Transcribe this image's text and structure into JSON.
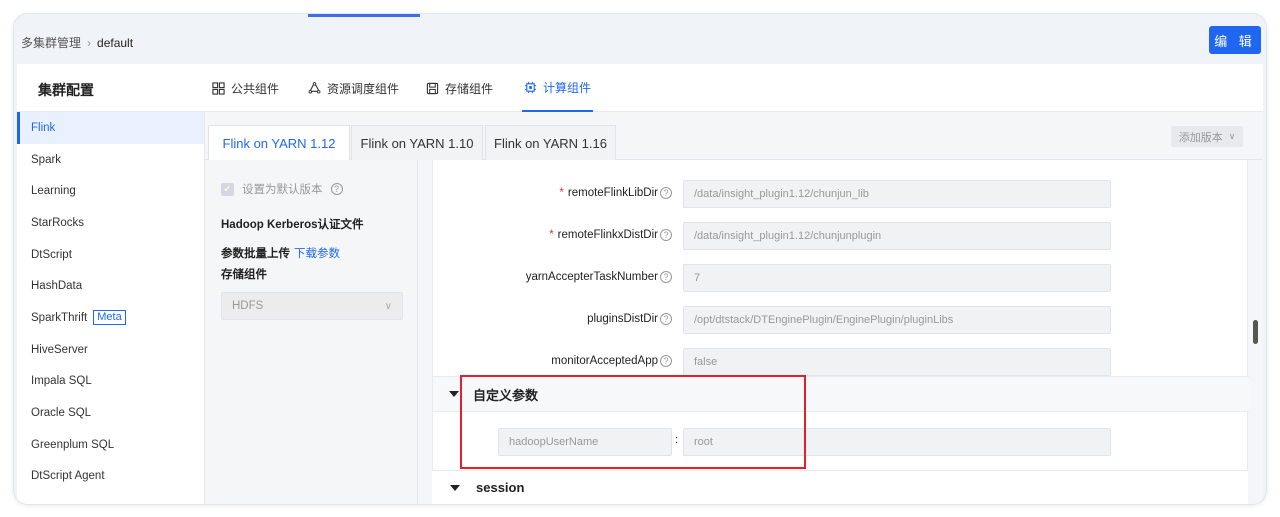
{
  "breadcrumb": {
    "root": "多集群管理",
    "current": "default"
  },
  "header": {
    "edit_label": "编 辑"
  },
  "cluster": {
    "title": "集群配置"
  },
  "main_tabs": [
    {
      "label": "公共组件",
      "icon": "grid-icon"
    },
    {
      "label": "资源调度组件",
      "icon": "cluster-icon"
    },
    {
      "label": "存储组件",
      "icon": "save-icon"
    },
    {
      "label": "计算组件",
      "icon": "chip-icon",
      "active": true
    }
  ],
  "sidebar": {
    "items": [
      {
        "label": "Flink",
        "active": true
      },
      {
        "label": "Spark"
      },
      {
        "label": "Learning"
      },
      {
        "label": "StarRocks"
      },
      {
        "label": "DtScript"
      },
      {
        "label": "HashData"
      },
      {
        "label": "SparkThrift",
        "badge": "Meta"
      },
      {
        "label": "HiveServer"
      },
      {
        "label": "Impala SQL"
      },
      {
        "label": "Oracle SQL"
      },
      {
        "label": "Greenplum SQL"
      },
      {
        "label": "DtScript Agent"
      }
    ]
  },
  "version_tabs": [
    {
      "label": "Flink on YARN 1.12",
      "active": true
    },
    {
      "label": "Flink on YARN 1.10"
    },
    {
      "label": "Flink on YARN 1.16"
    }
  ],
  "add_version_label": "添加版本",
  "left_panel": {
    "default_version_label": "设置为默认版本",
    "kerberos_label": "Hadoop Kerberos认证文件",
    "batch_upload_label": "参数批量上传",
    "download_params_link": "下载参数",
    "storage_label": "存储组件",
    "storage_value": "HDFS"
  },
  "form": {
    "fields": [
      {
        "label": "remoteFlinkLibDir",
        "required": true,
        "value": "/data/insight_plugin1.12/chunjun_lib"
      },
      {
        "label": "remoteFlinkxDistDir",
        "required": true,
        "value": "/data/insight_plugin1.12/chunjunplugin"
      },
      {
        "label": "yarnAccepterTaskNumber",
        "required": false,
        "value": "7"
      },
      {
        "label": "pluginsDistDir",
        "required": false,
        "value": "/opt/dtstack/DTEnginePlugin/EnginePlugin/pluginLibs"
      },
      {
        "label": "monitorAcceptedApp",
        "required": false,
        "value": "false"
      }
    ],
    "custom_params_title": "自定义参数",
    "custom_param": {
      "key": "hadoopUserName",
      "separator": ":",
      "value": "root"
    },
    "session_title": "session"
  },
  "colors": {
    "accent": "#1f67f0",
    "highlight": "#e0202a",
    "required": "#e0343a"
  }
}
